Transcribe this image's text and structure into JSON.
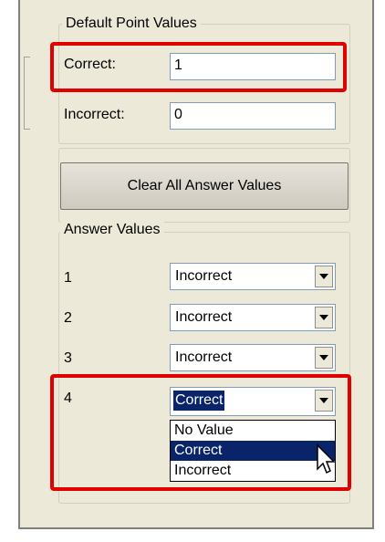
{
  "default_points": {
    "title": "Default Point Values",
    "correct_label": "Correct:",
    "correct_value": "1",
    "incorrect_label": "Incorrect:",
    "incorrect_value": "0"
  },
  "clear_button": "Clear All Answer Values",
  "answer_values": {
    "title": "Answer Values",
    "rows": [
      {
        "number": "1",
        "value": "Incorrect"
      },
      {
        "number": "2",
        "value": "Incorrect"
      },
      {
        "number": "3",
        "value": "Incorrect"
      },
      {
        "number": "4",
        "value": "Correct"
      }
    ],
    "dropdown_options": [
      "No Value",
      "Correct",
      "Incorrect"
    ],
    "highlighted_option": "Correct"
  },
  "colors": {
    "highlight": "#e00000",
    "selection": "#0a246a",
    "panel_background": "#ece9d8"
  },
  "icons": [
    "dropdown-arrow-icon",
    "mouse-pointer-icon"
  ]
}
